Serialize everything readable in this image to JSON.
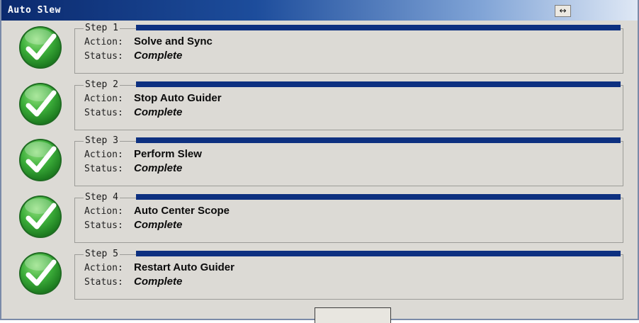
{
  "window": {
    "title": "Auto Slew",
    "title_button_icon": "resize-horizontal-icon",
    "title_button_glyph": "↔"
  },
  "colors": {
    "title_start": "#0b2a6e",
    "progress": "#0d3080",
    "check_green": "#3cae3a",
    "background": "#dcdad5"
  },
  "labels": {
    "action": "Action:",
    "status": "Status:"
  },
  "steps": [
    {
      "name": "Step 1",
      "action": "Solve and Sync",
      "status": "Complete",
      "progress": 1.0,
      "icon": "checkmark-icon"
    },
    {
      "name": "Step 2",
      "action": "Stop Auto Guider",
      "status": "Complete",
      "progress": 1.0,
      "icon": "checkmark-icon"
    },
    {
      "name": "Step 3",
      "action": "Perform Slew",
      "status": "Complete",
      "progress": 1.0,
      "icon": "checkmark-icon"
    },
    {
      "name": "Step 4",
      "action": "Auto Center Scope",
      "status": "Complete",
      "progress": 1.0,
      "icon": "checkmark-icon"
    },
    {
      "name": "Step 5",
      "action": "Restart Auto Guider",
      "status": "Complete",
      "progress": 1.0,
      "icon": "checkmark-icon"
    }
  ],
  "footer_button": {
    "label": ""
  }
}
